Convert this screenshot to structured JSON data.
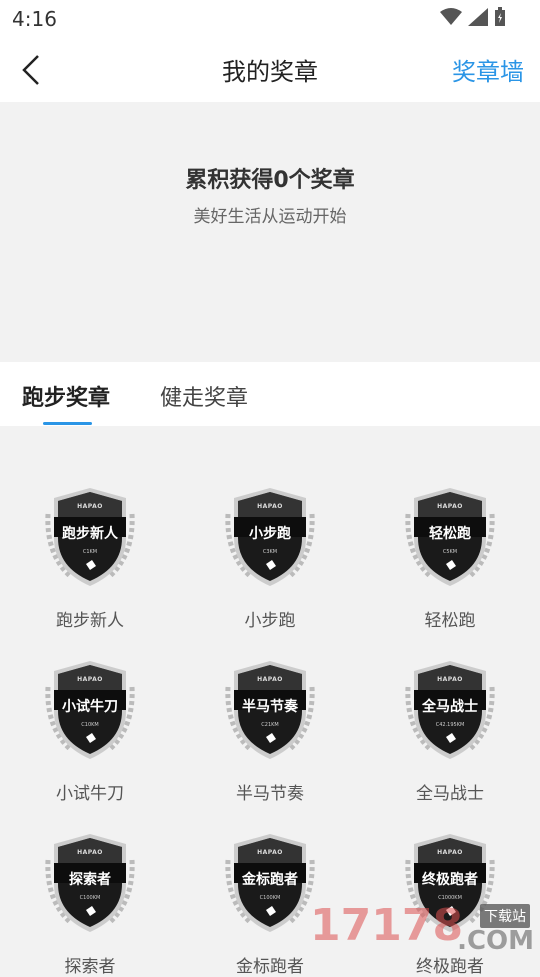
{
  "status": {
    "time": "4:16"
  },
  "header": {
    "title": "我的奖章",
    "right_action": "奖章墙"
  },
  "summary": {
    "title": "累积获得0个奖章",
    "subtitle": "美好生活从运动开始"
  },
  "tabs": [
    {
      "label": "跑步奖章"
    },
    {
      "label": "健走奖章"
    }
  ],
  "badges": [
    {
      "name": "跑步新人",
      "sub": "C1KM"
    },
    {
      "name": "小步跑",
      "sub": "C3KM"
    },
    {
      "name": "轻松跑",
      "sub": "C5KM"
    },
    {
      "name": "小试牛刀",
      "sub": "C10KM"
    },
    {
      "name": "半马节奏",
      "sub": "C21KM"
    },
    {
      "name": "全马战士",
      "sub": "C42.195KM"
    },
    {
      "name": "探索者",
      "sub": "C100KM"
    },
    {
      "name": "金标跑者",
      "sub": "C100KM"
    },
    {
      "name": "终极跑者",
      "sub": "C1000KM"
    }
  ],
  "badge_brand": "HAPAO",
  "badge_labels": [
    "跑步新人",
    "小步跑",
    "轻松跑",
    "小试牛刀",
    "半马节奏",
    "全马战士",
    "探索者",
    "金标跑者",
    "终极跑者"
  ],
  "watermark": {
    "number": "17178",
    "site": "下载站",
    "com": ".COM"
  },
  "colors": {
    "accent": "#2a95e6",
    "badge_dark": "#1a1a1a"
  }
}
